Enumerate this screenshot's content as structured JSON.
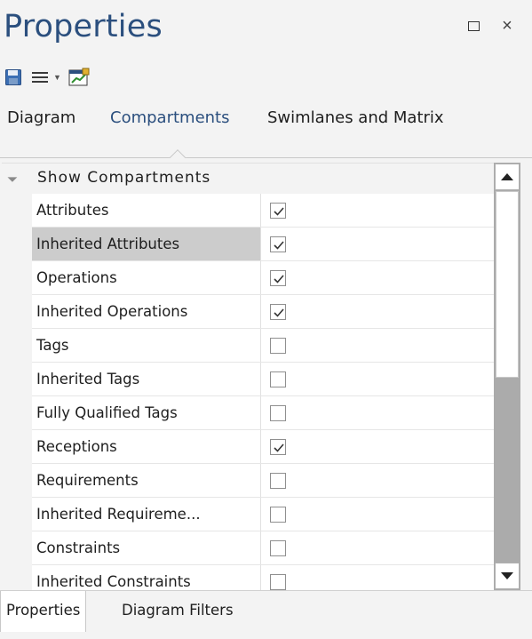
{
  "window": {
    "title": "Properties",
    "restore_icon": "restore-icon",
    "close_icon": "close-icon",
    "close_glyph": "×"
  },
  "toolbar": {
    "icons": [
      "save-icon",
      "menu-icon",
      "chevron-down-icon",
      "chart-icon"
    ]
  },
  "tabs": {
    "items": [
      {
        "label": "Diagram"
      },
      {
        "label": "Compartments"
      },
      {
        "label": "Swimlanes and Matrix"
      }
    ],
    "active": "Compartments"
  },
  "grid": {
    "group_label": "Show Compartments",
    "rows": [
      {
        "name": "Attributes",
        "checked": true
      },
      {
        "name": "Inherited Attributes",
        "checked": true,
        "selected": true
      },
      {
        "name": "Operations",
        "checked": true
      },
      {
        "name": "Inherited Operations",
        "checked": true
      },
      {
        "name": "Tags",
        "checked": false
      },
      {
        "name": "Inherited Tags",
        "checked": false
      },
      {
        "name": "Fully Qualified Tags",
        "checked": false
      },
      {
        "name": "Receptions",
        "checked": true
      },
      {
        "name": "Requirements",
        "checked": false
      },
      {
        "name": "Inherited Requireme...",
        "checked": false
      },
      {
        "name": "Constraints",
        "checked": false
      },
      {
        "name": "Inherited Constraints",
        "checked": false
      }
    ]
  },
  "bottom_tabs": {
    "items": [
      {
        "label": "Properties"
      },
      {
        "label": "Diagram Filters"
      }
    ],
    "active": "Properties"
  },
  "colors": {
    "accent": "#2b4f7e",
    "selected_row": "#cccccc"
  }
}
